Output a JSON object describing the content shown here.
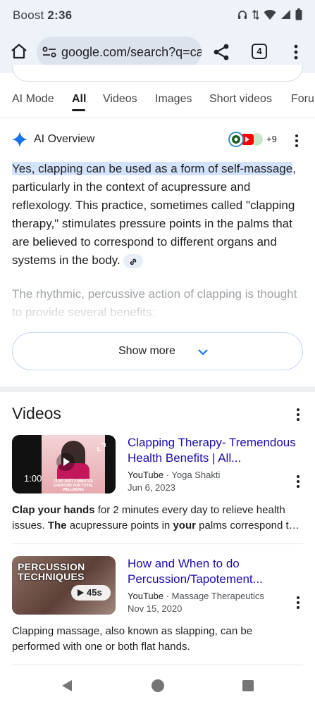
{
  "status": {
    "carrier": "Boost",
    "time": "2:36"
  },
  "browser": {
    "url": "google.com/search?q=ca",
    "tab_count": "4"
  },
  "search_tabs": [
    "AI Mode",
    "All",
    "Videos",
    "Images",
    "Short videos",
    "Foru"
  ],
  "active_tab": "All",
  "ai_overview": {
    "title": "AI Overview",
    "source_count": "+9",
    "highlight": "Yes, clapping can be used as a form of self-massage",
    "body_rest": ", particularly in the context of acupressure and reflexology. This practice, sometimes called \"clapping therapy,\" stimulates pressure points in the palms that are believed to correspond to different organs and systems in the body.",
    "fade_text": "The rhythmic, percussive action of clapping is thought to provide several benefits:",
    "show_more": "Show more"
  },
  "videos": {
    "title": "Videos",
    "items": [
      {
        "title": "Clapping Therapy- Tremendous Health Benefits | All...",
        "platform": "YouTube",
        "channel": "Yoga Shakti",
        "date": "Jun 6, 2023",
        "duration": "1:00",
        "thumb_caption": "CLAP JUST 2 MINUTES EVERYDAY FOR TOTAL WELLBEING",
        "desc_parts": [
          {
            "t": "Clap your hands",
            "b": true
          },
          {
            "t": " for 2 minutes every day to relieve health issues. ",
            "b": false
          },
          {
            "t": "The",
            "b": true
          },
          {
            "t": " acupressure points in ",
            "b": false
          },
          {
            "t": "your",
            "b": true
          },
          {
            "t": " palms correspond t…",
            "b": false
          }
        ]
      },
      {
        "title": "How and When to do Percussion/Tapotement...",
        "platform": "YouTube",
        "channel": "Massage Therapeutics",
        "date": "Nov 15, 2020",
        "duration": "45s",
        "thumb_caption": "PERCUSSION TECHNIQUES",
        "desc": "Clapping massage, also known as slapping, can be performed with one or both flat hands."
      }
    ]
  },
  "colors": {
    "accent": "#1a73e8",
    "link": "#1a0dab",
    "highlight": "#d3e3fd",
    "chrome": "#eef2f9"
  }
}
